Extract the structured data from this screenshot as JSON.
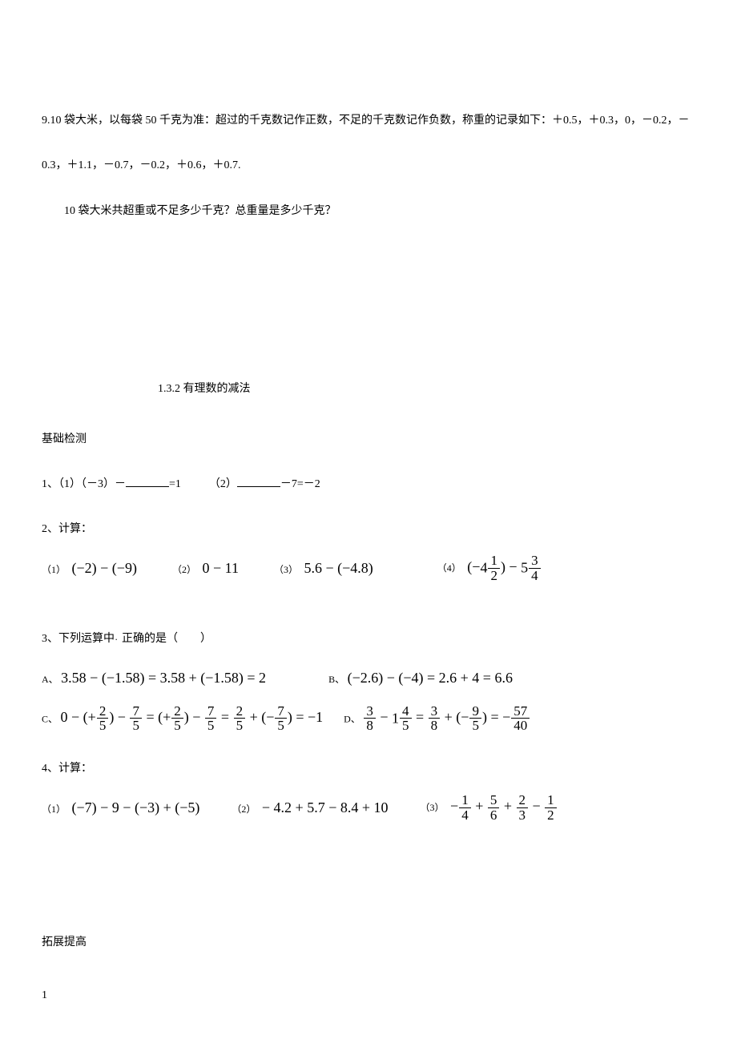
{
  "q9": {
    "line1": "9.10 袋大米，以每袋 50 千克为准：超过的千克数记作正数，不足的千克数记作负数，称重的记录如下：＋0.5，＋0.3，0，－0.2，－",
    "line2": "0.3，＋1.1，－0.7，－0.2，＋0.6，＋0.7.",
    "line3": "10 袋大米共超重或不足多少千克？总重量是多少千克？"
  },
  "sectionTitle": "1.3.2 有理数的减法",
  "basicLabel": "基础检测",
  "q1": {
    "prefix": "1、（1）（－3）－",
    "mid": "=1　　　（2）",
    "suffix": "－7=－2"
  },
  "q2": {
    "head": "2、计算：",
    "p1_l": "（1）",
    "p1": "(−2) − (−9)",
    "p2_l": "（2）",
    "p2": "0 − 11",
    "p3_l": "（3）",
    "p3": "5.6 − (−4.8)",
    "p4_l": "（4）"
  },
  "q3": {
    "head": "3、下列运算中",
    "dot": "．",
    "tail": "正确的是（　　）",
    "A_l": "A、",
    "A": "3.58 − (−1.58) = 3.58 + (−1.58) = 2",
    "B_l": "B、",
    "B": "(−2.6) − (−4) = 2.6 + 4 = 6.6",
    "C_l": "C、",
    "D_l": "D、"
  },
  "q4": {
    "head": "4、计算：",
    "p1_l": "（1）",
    "p1": "(−7) − 9 − (−3) + (−5)",
    "p2_l": "（2）",
    "p2": "− 4.2 + 5.7 − 8.4 + 10",
    "p3_l": "（3）"
  },
  "extLabel": "拓展提高",
  "pageNum": "1"
}
